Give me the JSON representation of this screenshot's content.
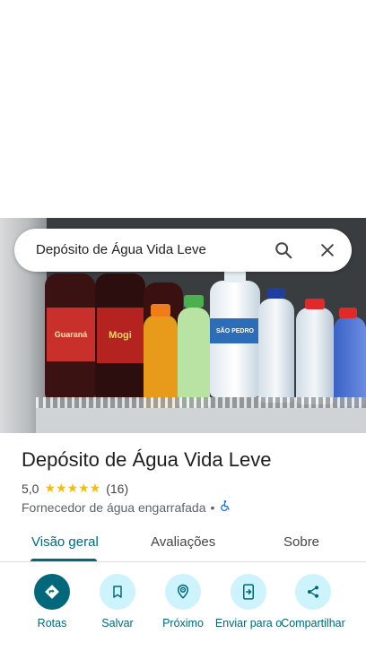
{
  "search": {
    "query": "Depósito de Água Vida Leve"
  },
  "place": {
    "title": "Depósito de Água Vida Leve",
    "rating": "5,0",
    "rating_value": 5.0,
    "stars": "★★★★★",
    "review_count": "(16)",
    "category": "Fornecedor de água engarrafada",
    "separator": "•"
  },
  "tabs": [
    {
      "label": "Visão geral",
      "active": true
    },
    {
      "label": "Avaliações",
      "active": false
    },
    {
      "label": "Sobre",
      "active": false
    }
  ],
  "actions": [
    {
      "label": "Rotas",
      "icon": "directions-icon"
    },
    {
      "label": "Salvar",
      "icon": "bookmark-icon"
    },
    {
      "label": "Próximo",
      "icon": "nearby-icon"
    },
    {
      "label": "Enviar para o",
      "icon": "send-to-phone-icon"
    },
    {
      "label": "Compartilhar",
      "icon": "share-icon"
    }
  ],
  "photo": {
    "bottle_labels": [
      "Guaraná",
      "Mogi",
      "SÃO PEDRO"
    ]
  },
  "colors": {
    "accent": "#00687a",
    "accent_light": "#cdf3fc",
    "star": "#fbbc04",
    "accessible_icon": "#1a73e8"
  }
}
